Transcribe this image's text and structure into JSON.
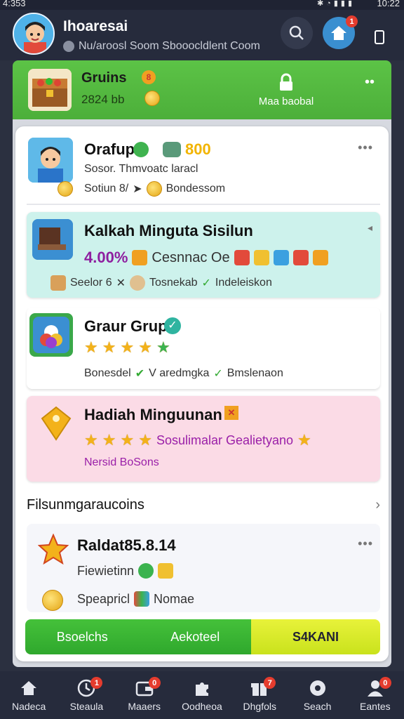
{
  "status_bar": {
    "time_left": "4:353",
    "time_right": "10:22",
    "icons": [
      "bluetooth-icon",
      "wifi-icon",
      "signal-icon",
      "battery-icon"
    ]
  },
  "header": {
    "title": "Ihoaresai",
    "subtitle": "Nu/aroosl Soom Sbooocldlent Coom",
    "home_badge": "1",
    "icons": [
      "avatar",
      "search-icon",
      "home-icon",
      "phone-icon"
    ]
  },
  "banner": {
    "title": "Gruins",
    "badge": "8",
    "value": "2824 bb",
    "action_label": "Maa baobal",
    "accent": "#4caf3a"
  },
  "cards": [
    {
      "title": "Orafup",
      "coins": "800",
      "line1": "Sosor. Thmvoatc laracl",
      "line2_a": "Sotiun 8/",
      "line2_b": "Bondessom"
    },
    {
      "title": "Kalkah Minguta Sisilun",
      "percent": "4.00%",
      "line1_text": "Cesnnac Oe",
      "line2_a": "Seelor 6",
      "line2_b": "Tosnekab",
      "line2_c": "Indeleiskon",
      "accent": "#cdf2ec",
      "percent_color": "#8e1fa0"
    },
    {
      "title": "Graur Grup",
      "line2_a": "Bonesdel",
      "line2_b": "V aredmgka",
      "line2_c": "Bmslenaon"
    },
    {
      "title": "Hadiah Minguunan",
      "line1_text": "Sosulimalar Gealietyano",
      "line2": "Nersid BoSons",
      "accent": "#fbdbe6",
      "line_color": "#9a1fa8"
    }
  ],
  "section": {
    "title": "Filsunmgaraucoins"
  },
  "featured": {
    "title": "Raldat85.8.14",
    "line1": "Fiewietinn",
    "line2": "Speapricl",
    "line2_b": "Nomae"
  },
  "actions": {
    "left_a": "Bsoelchs",
    "left_b": "Aekoteel",
    "right": "S4KANI"
  },
  "bottom_nav": [
    {
      "label": "Nadeca",
      "icon": "home-icon",
      "badge": ""
    },
    {
      "label": "Steaula",
      "icon": "clock-icon",
      "badge": "1"
    },
    {
      "label": "Maaers",
      "icon": "wallet-icon",
      "badge": "0"
    },
    {
      "label": "Oodheoa",
      "icon": "puzzle-icon",
      "badge": ""
    },
    {
      "label": "Dhgfols",
      "icon": "gift-icon",
      "badge": "7"
    },
    {
      "label": "Seach",
      "icon": "explore-icon",
      "badge": ""
    },
    {
      "label": "Eantes",
      "icon": "user-icon",
      "badge": "0"
    }
  ]
}
